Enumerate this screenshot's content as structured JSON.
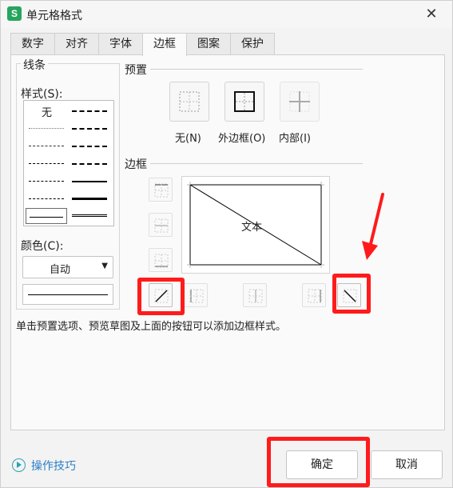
{
  "window": {
    "app_icon_letter": "S",
    "title": "单元格格式",
    "close_glyph": "✕"
  },
  "tabs": [
    {
      "label": "数字"
    },
    {
      "label": "对齐"
    },
    {
      "label": "字体"
    },
    {
      "label": "边框"
    },
    {
      "label": "图案"
    },
    {
      "label": "保护"
    }
  ],
  "active_tab": "边框",
  "lines": {
    "group_title": "线条",
    "style_label": "样式(S):",
    "style_none": "无",
    "color_label": "颜色(C):",
    "color_value": "自动",
    "line_color": "#000000"
  },
  "presets": {
    "group_title": "预置",
    "items": [
      {
        "label": "无(N)"
      },
      {
        "label": "外边框(O)"
      },
      {
        "label": "内部(I)"
      }
    ]
  },
  "border": {
    "group_title": "边框",
    "preview_text": "文本"
  },
  "hint": "单击预置选项、预览草图及上面的按钮可以添加边框样式。",
  "help_label": "操作技巧",
  "buttons": {
    "ok": "确定",
    "cancel": "取消"
  },
  "colors": {
    "accent": "#26a55f",
    "link": "#2a7ec7",
    "highlight": "#ff1b1b"
  }
}
